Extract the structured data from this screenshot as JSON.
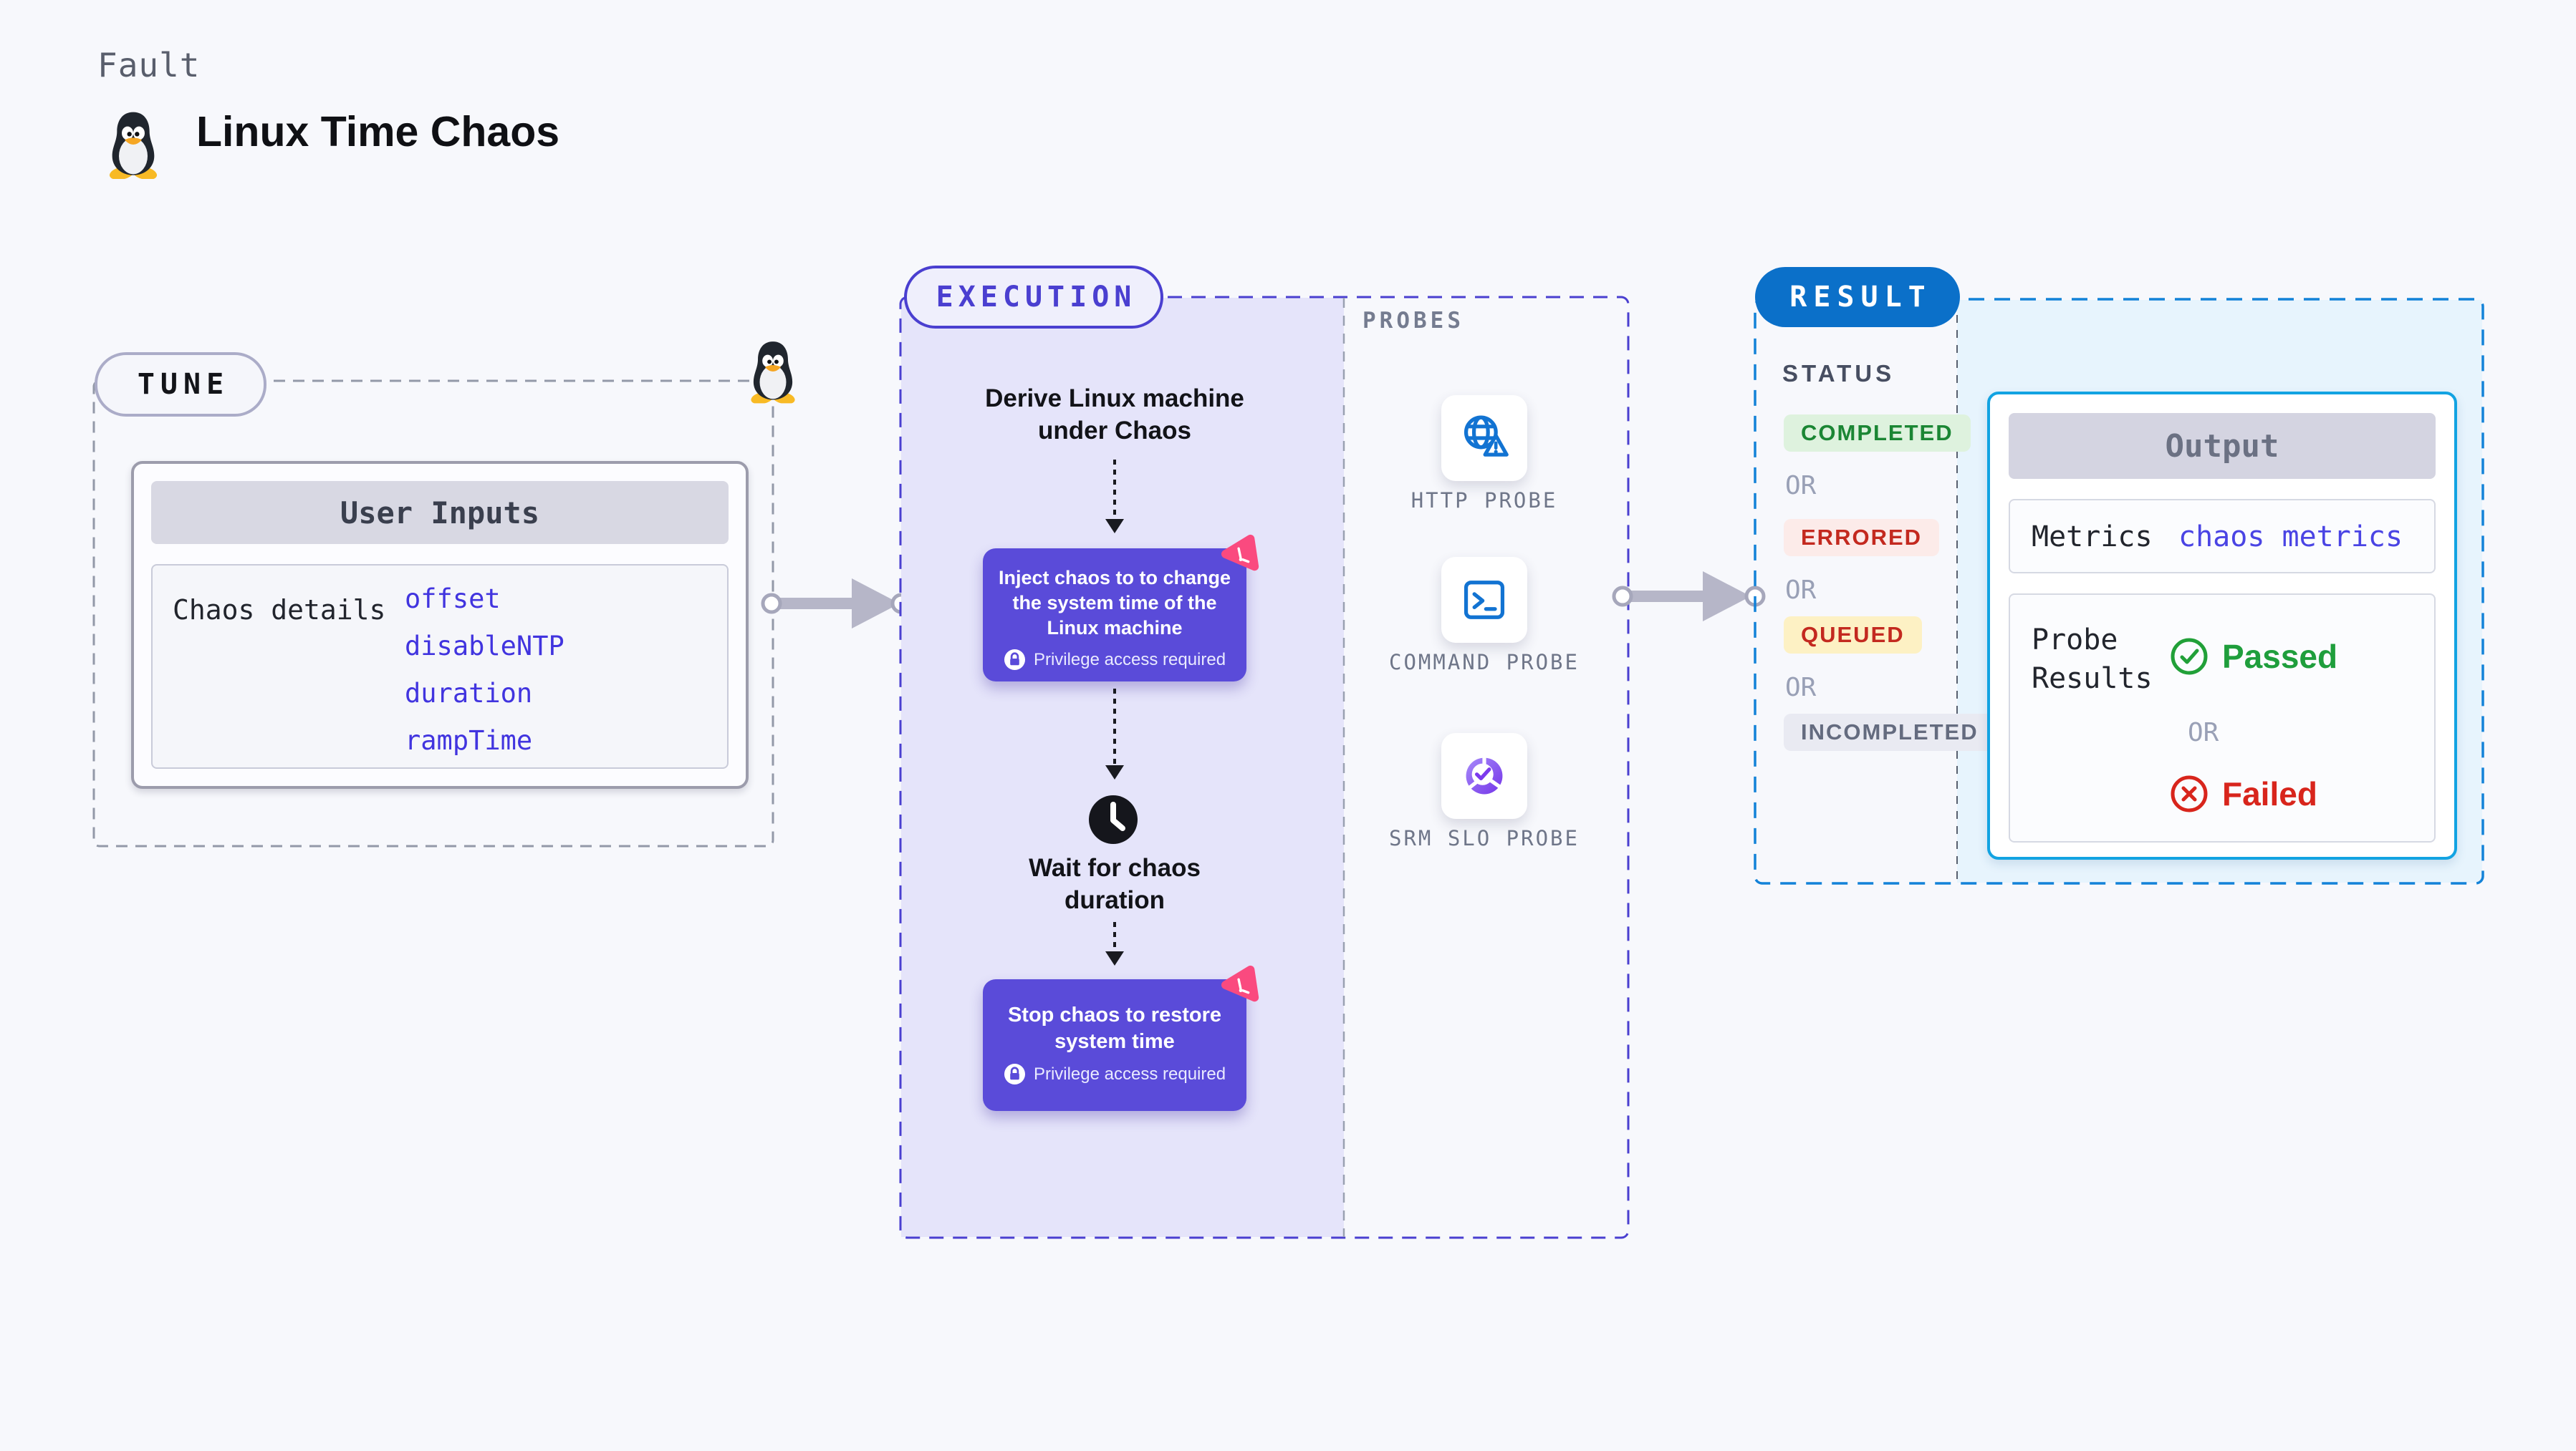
{
  "page": {
    "kicker": "Fault",
    "title": "Linux Time Chaos"
  },
  "tune": {
    "badge": "TUNE",
    "user_inputs": {
      "header": "User Inputs",
      "row_label": "Chaos details",
      "params": [
        "offset",
        "disableNTP",
        "duration",
        "rampTime"
      ]
    }
  },
  "execution": {
    "badge": "EXECUTION",
    "steps": {
      "derive": "Derive Linux machine under Chaos",
      "inject": "Inject chaos to to change the system time of the Linux machine",
      "wait": "Wait for chaos duration",
      "stop": "Stop chaos to restore system time",
      "privilege_note": "Privilege access required"
    }
  },
  "probes": {
    "label": "PROBES",
    "items": [
      {
        "label": "HTTP PROBE",
        "icon": "globe-warning-icon"
      },
      {
        "label": "COMMAND PROBE",
        "icon": "terminal-icon"
      },
      {
        "label": "SRM SLO PROBE",
        "icon": "slo-donut-check-icon"
      }
    ]
  },
  "result": {
    "badge": "RESULT",
    "status": {
      "label": "STATUS",
      "separator": "OR",
      "values": [
        "COMPLETED",
        "ERRORED",
        "QUEUED",
        "INCOMPLETED"
      ]
    },
    "output": {
      "header": "Output",
      "metrics_label": "Metrics",
      "metrics_value": "chaos metrics",
      "probe_results_label": "Probe Results",
      "passed": "Passed",
      "separator": "OR",
      "failed": "Failed"
    }
  },
  "colors": {
    "page_background": "#f7f8fc",
    "execution_accent": "#4a3fd0",
    "execution_fill": "#e5e4fa",
    "node_purple": "#5a4bd9",
    "chaos_pink": "#fa4a7f",
    "result_badge_blue": "#0b70c9",
    "result_border_blue": "#1382d8",
    "result_fill": "#e7f4fd",
    "output_border_cyan": "#12a3e2",
    "probe_icon_blue": "#1273d2",
    "param_indigo": "#4134df",
    "completed_green": "#1b8634",
    "errored_red": "#c3291f",
    "queued_yellow_bg": "#fdf1c4",
    "passed_green": "#1f9e3c",
    "failed_red": "#d8251c"
  }
}
